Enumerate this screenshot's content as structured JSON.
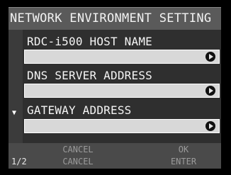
{
  "title": "NETWORK ENVIRONMENT SETTING",
  "items": [
    {
      "label": "RDC-i500 HOST NAME",
      "value": ""
    },
    {
      "label": "DNS SERVER ADDRESS",
      "value": ""
    },
    {
      "label": "GATEWAY ADDRESS",
      "value": ""
    }
  ],
  "scroll_indicator": "▼",
  "footer": {
    "page": "1/2",
    "left_top": "CANCEL",
    "left_bottom": "CANCEL",
    "right_top": "OK",
    "right_bottom": "ENTER"
  },
  "icons": {
    "field_action": "right-arrow-circle-icon",
    "scroll": "scroll-down-indicator-icon"
  },
  "colors": {
    "title_bar": "#5a5a5a",
    "menu_background": "#2f2f2f",
    "field_background": "#d8d8d8",
    "footer_background": "#4a4a4a"
  }
}
